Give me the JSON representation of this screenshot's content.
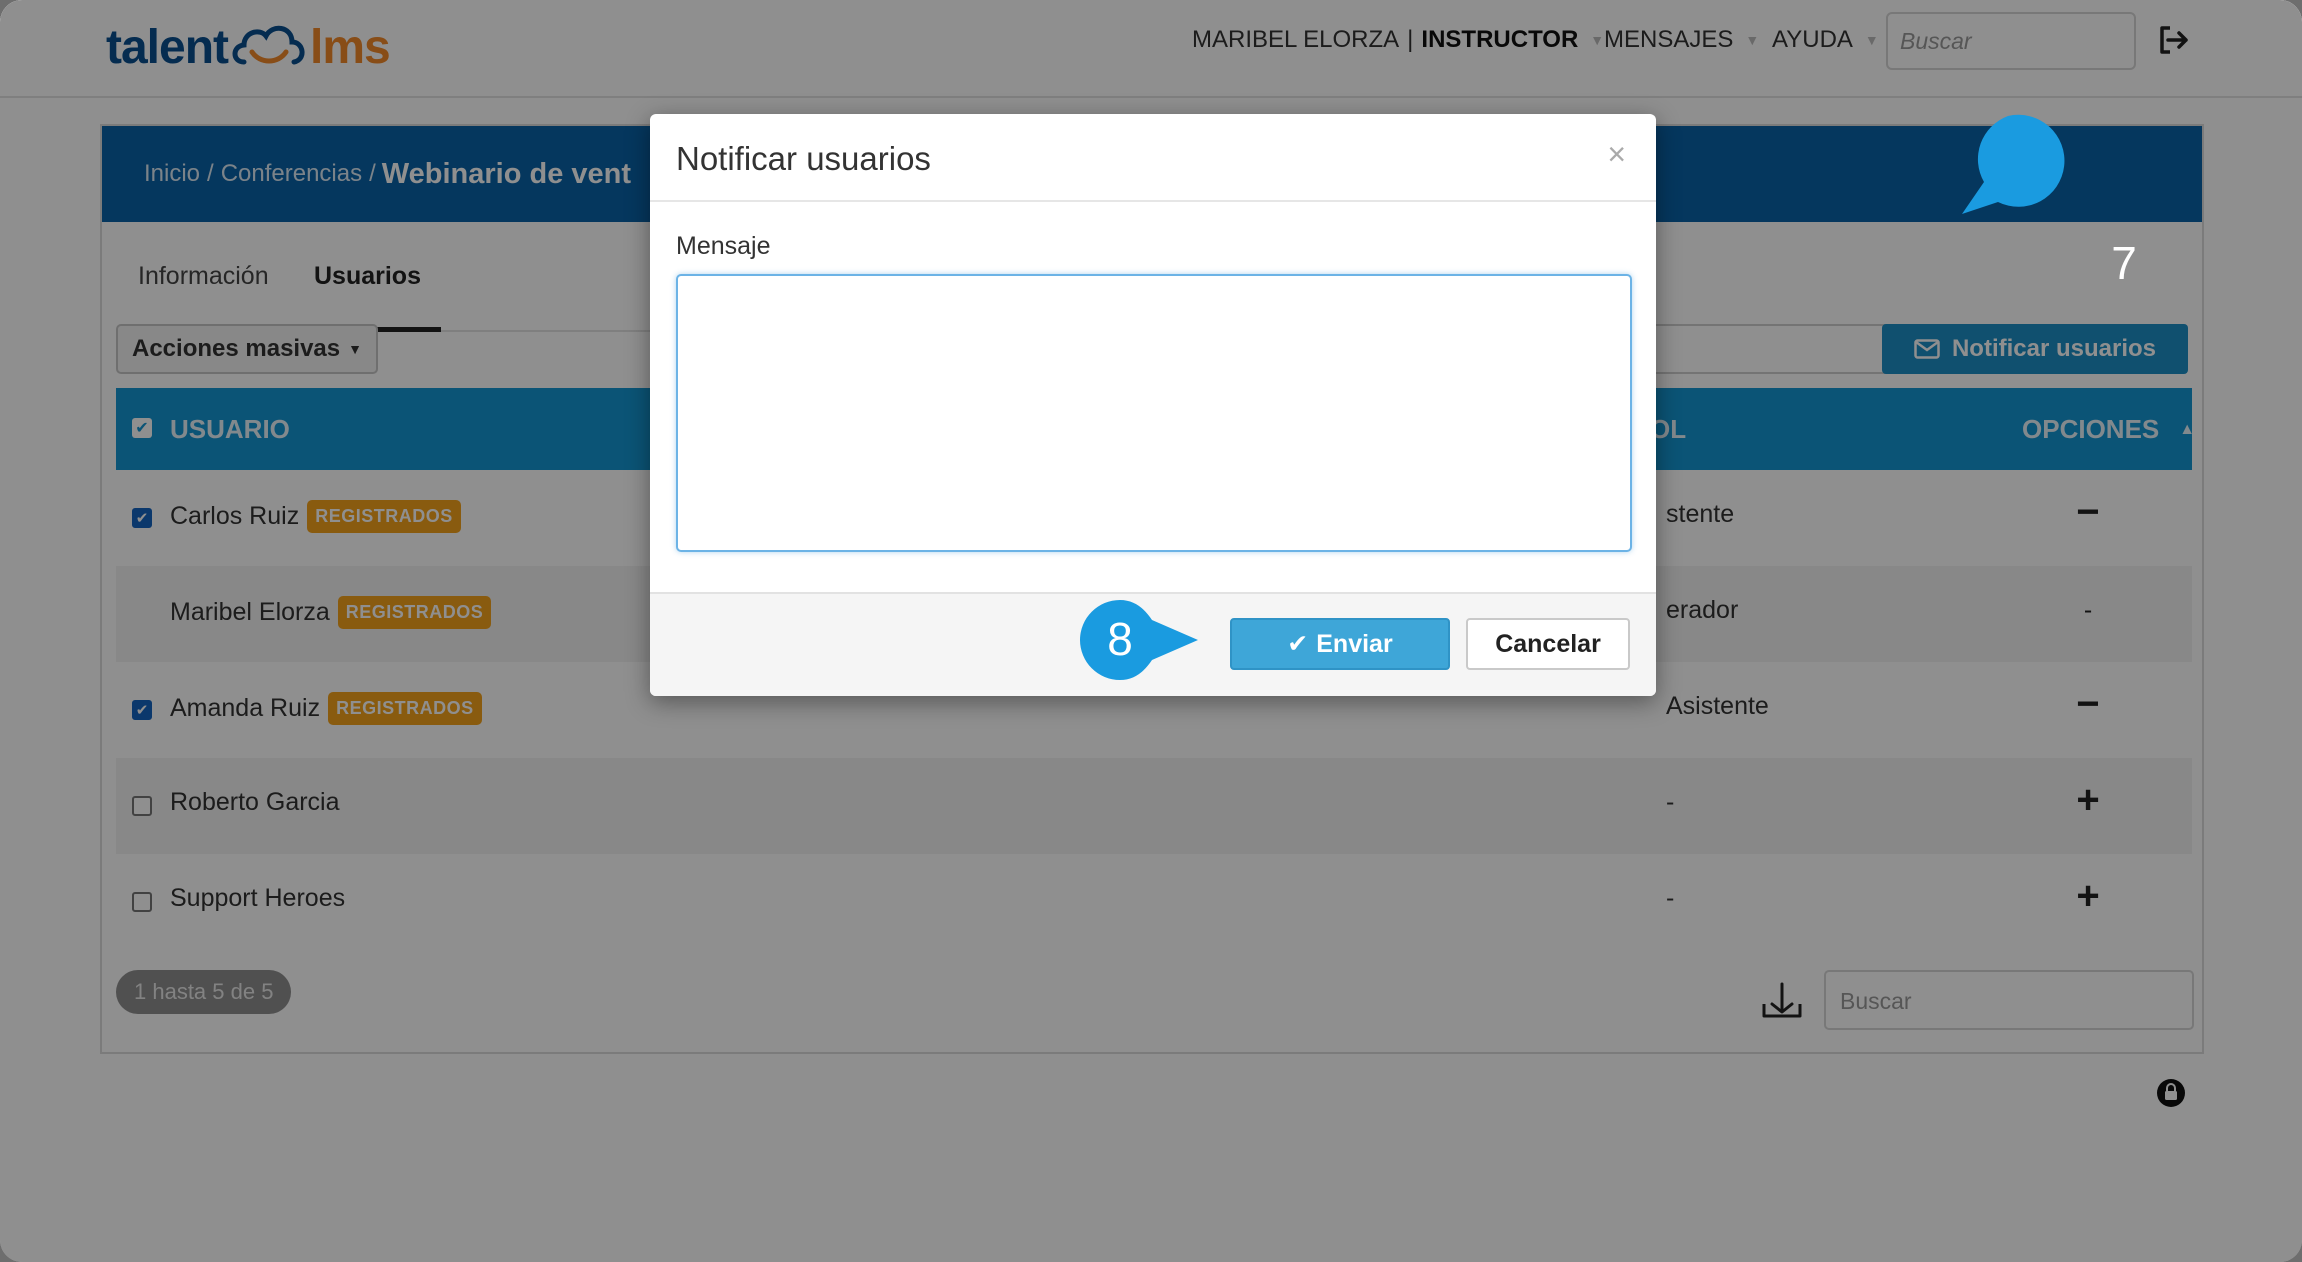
{
  "logo": {
    "part1": "talent",
    "part2": "lms"
  },
  "nav": {
    "user_name": "MARIBEL ELORZA",
    "separator": "|",
    "role": "INSTRUCTOR",
    "messages": "MENSAJES",
    "help": "AYUDA",
    "search_placeholder": "Buscar"
  },
  "breadcrumb": {
    "home": "Inicio",
    "section": "Conferencias",
    "separator": "/",
    "current": "Webinario de vent"
  },
  "tabs": [
    {
      "label": "Información"
    },
    {
      "label": "Usuarios"
    }
  ],
  "toolbar": {
    "bulk_actions": "Acciones masivas",
    "notify_users": "Notificar usuarios"
  },
  "table": {
    "headers": {
      "user": "USUARIO",
      "role": "OL",
      "options": "OPCIONES"
    },
    "rows": [
      {
        "name": "Carlos Ruiz",
        "badge": "REGISTRADOS",
        "role": "stente",
        "option": "−",
        "checked": true
      },
      {
        "name": "Maribel Elorza",
        "badge": "REGISTRADOS",
        "role": "erador",
        "option": "-",
        "checked": false
      },
      {
        "name": "Amanda Ruiz",
        "badge": "REGISTRADOS",
        "role": "Asistente",
        "option": "−",
        "checked": true
      },
      {
        "name": "Roberto Garcia",
        "badge": "",
        "role": "-",
        "option": "+",
        "checked": false
      },
      {
        "name": "Support Heroes",
        "badge": "",
        "role": "-",
        "option": "+",
        "checked": false
      }
    ]
  },
  "pager": {
    "text": "1 hasta 5 de 5"
  },
  "bottom_search": {
    "placeholder": "Buscar"
  },
  "modal": {
    "title": "Notificar usuarios",
    "close": "×",
    "message_label": "Mensaje",
    "message_value": "",
    "send": "Enviar",
    "cancel": "Cancelar"
  },
  "callouts": {
    "step7": "7",
    "step8": "8"
  },
  "colors": {
    "brand_blue": "#0a63a8",
    "header_blue": "#1596d3",
    "accent_orange": "#f4a21b",
    "callout": "#1a9be0"
  }
}
